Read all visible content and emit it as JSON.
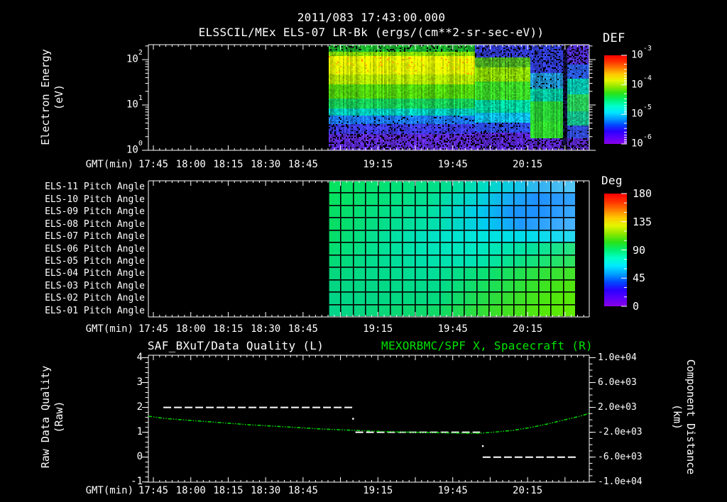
{
  "colors": {
    "background": "#000000",
    "foreground": "#ffffff",
    "title_green": "#00e400",
    "curve_green": "#00cf00",
    "quality_white": "#ffffff",
    "grid_black": "#000000",
    "rainbow_stops_bottom_to_top": [
      "#8a00e8",
      "#5a00fa",
      "#2a00ff",
      "#0048ff",
      "#00a0ff",
      "#00e8ff",
      "#00ffc8",
      "#00f070",
      "#2ce216",
      "#8ce800",
      "#e4f600",
      "#ffc800",
      "#ff7a00",
      "#ff3000",
      "#ff0000"
    ]
  },
  "header": {
    "line1": "2011/083 17:43:00.000",
    "line2": "ELSSCIL/MEx ELS-07 LR-Bk  (ergs/(cm**2-sr-sec-eV))"
  },
  "time_axis": {
    "label": "GMT(min)",
    "start": "17:43",
    "end": "20:40",
    "minutes_total": 176.7,
    "major_step_min": 15,
    "minor_step_min": 2.5,
    "first_tick_min": 2,
    "labels": [
      {
        "text": "17:45",
        "min": 2
      },
      {
        "text": "18:00",
        "min": 17
      },
      {
        "text": "18:15",
        "min": 32
      },
      {
        "text": "18:30",
        "min": 47
      },
      {
        "text": "18:45",
        "min": 62
      },
      {
        "text": "19:15",
        "min": 92
      },
      {
        "text": "19:45",
        "min": 122
      },
      {
        "text": "20:15",
        "min": 152
      }
    ]
  },
  "top_panel": {
    "ylabel": [
      "Electron Energy",
      "(eV)"
    ],
    "y_tick_exponents": [
      2,
      1,
      0
    ],
    "y_max_exponent": 2.33,
    "colorbar": {
      "title": "DEF",
      "tick_exponents": [
        -3,
        -4,
        -5,
        -6
      ]
    }
  },
  "mid_panel": {
    "row_labels": [
      "ELS-11 Pitch Angle",
      "ELS-10 Pitch Angle",
      "ELS-09 Pitch Angle",
      "ELS-08 Pitch Angle",
      "ELS-07 Pitch Angle",
      "ELS-06 Pitch Angle",
      "ELS-05 Pitch Angle",
      "ELS-04 Pitch Angle",
      "ELS-03 Pitch Angle",
      "ELS-02 Pitch Angle",
      "ELS-01 Pitch Angle"
    ],
    "colorbar": {
      "title": "Deg",
      "ticks": [
        180,
        135,
        90,
        45,
        0
      ],
      "minor_step": 15,
      "range": [
        0,
        180
      ]
    }
  },
  "bottom_panel": {
    "title_left": "SAF_BXuT/Data Quality (L)",
    "title_right": "MEXORBMC/SPF X, Spacecraft (R)",
    "ylabel_left": [
      "Raw Data Quality",
      "(Raw)"
    ],
    "ylabel_right": [
      "Component Distance",
      "(km)"
    ],
    "left_axis": {
      "ticks": [
        4,
        3,
        2,
        1,
        0,
        -1
      ],
      "minor_step": 0.2
    },
    "right_axis": {
      "tick_labels": [
        "1.0e+04",
        "6.0e+03",
        "2.0e+03",
        "-2.0e+03",
        "-6.0e+03",
        "-1.0e+04"
      ],
      "tick_values": [
        10000,
        6000,
        2000,
        -2000,
        -6000,
        -10000
      ],
      "range": [
        -10000,
        10000
      ],
      "minor_step": 1000
    }
  },
  "chart_data": [
    {
      "type": "heatmap",
      "name": "electron-energy-spectrogram",
      "title": "ELSSCIL/MEx ELS-07 LR-Bk",
      "units": "ergs/(cm**2-sr-sec-eV)",
      "x_start": "17:43",
      "x_end": "20:40",
      "data_start_min": 72,
      "data_end_min": 176.7,
      "y_scale": "log",
      "y_range_ev": [
        1,
        215
      ],
      "color_scale_range": [
        "1e-6",
        "1e-3"
      ],
      "segments": [
        {
          "x0": 0,
          "x1": 0.56,
          "bands": [
            {
              "y1": 0.055,
              "c": "#18a228",
              "n": 0.3,
              "b": 0.1
            },
            {
              "y1": 0.095,
              "c": "#7ed400",
              "n": 0.18
            },
            {
              "y1": 0.17,
              "c": "#e6f200",
              "n": 0.1,
              "sp": 0.05,
              "sc": "#ff9400"
            },
            {
              "y1": 0.27,
              "c": "#dcee00",
              "n": 0.1,
              "sp": 0.04,
              "sc": "#ffb000"
            },
            {
              "y1": 0.37,
              "c": "#adde00",
              "n": 0.12
            },
            {
              "y1": 0.5,
              "c": "#4ecc0c",
              "n": 0.14
            },
            {
              "y1": 0.595,
              "c": "#16c653",
              "n": 0.16
            },
            {
              "y1": 0.665,
              "c": "#00c2b2",
              "n": 0.2
            },
            {
              "y1": 0.74,
              "c": "#1a72ea",
              "n": 0.3,
              "b": 0.05
            },
            {
              "y1": 0.845,
              "c": "#3836d8",
              "n": 0.38,
              "b": 0.13
            },
            {
              "y1": 1,
              "c": "#5526c0",
              "n": 0.42,
              "b": 0.24
            }
          ]
        },
        {
          "x0": 0.56,
          "x1": 0.77,
          "bands": [
            {
              "y1": 0.11,
              "c": "#2c34bc",
              "n": 0.4,
              "b": 0.16
            },
            {
              "y1": 0.21,
              "c": "#48a41e",
              "n": 0.26
            },
            {
              "y1": 0.34,
              "c": "#84cc02",
              "n": 0.2
            },
            {
              "y1": 0.52,
              "c": "#38cc24",
              "n": 0.16
            },
            {
              "y1": 0.635,
              "c": "#00c896",
              "n": 0.2
            },
            {
              "y1": 0.725,
              "c": "#0ab0dc",
              "n": 0.22
            },
            {
              "y1": 0.83,
              "c": "#2a48dc",
              "n": 0.32,
              "b": 0.1
            },
            {
              "y1": 1,
              "c": "#4e22b8",
              "n": 0.42,
              "b": 0.22
            }
          ]
        },
        {
          "x0": 0.77,
          "x1": 0.895,
          "bands": [
            {
              "y1": 0.26,
              "c": "#2c38c4",
              "n": 0.4,
              "b": 0.18
            },
            {
              "y1": 0.41,
              "c": "#1e8cc8",
              "n": 0.3,
              "b": 0.06
            },
            {
              "y1": 0.53,
              "c": "#02be9a",
              "n": 0.2
            },
            {
              "y1": 0.72,
              "c": "#28cc34",
              "n": 0.12
            },
            {
              "y1": 0.875,
              "c": "#2ed42c",
              "n": 0.12
            },
            {
              "y1": 1,
              "c": "#5424bc",
              "n": 0.38,
              "b": 0.22
            }
          ]
        },
        {
          "x0": 0.895,
          "x1": 0.915,
          "bands": [
            {
              "y1": 1,
              "c": "#14103c",
              "n": 0.35,
              "b": 0.4
            }
          ]
        },
        {
          "x0": 0.915,
          "x1": 1,
          "bands": [
            {
              "y1": 0.18,
              "c": "#4c2ac2",
              "n": 0.38,
              "b": 0.22
            },
            {
              "y1": 0.31,
              "c": "#2858da",
              "n": 0.3,
              "b": 0.08
            },
            {
              "y1": 0.46,
              "c": "#04c2ae",
              "n": 0.2
            },
            {
              "y1": 0.63,
              "c": "#28cc58",
              "n": 0.16
            },
            {
              "y1": 0.76,
              "c": "#14bc8a",
              "n": 0.2
            },
            {
              "y1": 0.885,
              "c": "#2e48cc",
              "n": 0.32,
              "b": 0.12
            },
            {
              "y1": 1,
              "c": "#5022b2",
              "n": 0.38,
              "b": 0.26
            }
          ]
        }
      ]
    },
    {
      "type": "heatmap",
      "name": "pitch-angle-panels",
      "data_start_min": 72,
      "data_end_min": 171,
      "value_range_deg": [
        0,
        180
      ],
      "grid_columns": 20,
      "rows": [
        {
          "label": "ELS-11 Pitch Angle",
          "stops": [
            [
              0,
              "#06e25e"
            ],
            [
              0.45,
              "#00e08a"
            ],
            [
              0.62,
              "#00dcc0"
            ],
            [
              0.75,
              "#10c8e8"
            ],
            [
              0.86,
              "#38b2f2"
            ],
            [
              1,
              "#55c8f5"
            ]
          ]
        },
        {
          "label": "ELS-10 Pitch Angle",
          "stops": [
            [
              0,
              "#06e25e"
            ],
            [
              0.42,
              "#00e096"
            ],
            [
              0.6,
              "#00d4d8"
            ],
            [
              0.74,
              "#18a8f8"
            ],
            [
              0.84,
              "#1e90ff"
            ],
            [
              1,
              "#34a4ff"
            ]
          ]
        },
        {
          "label": "ELS-09 Pitch Angle",
          "stops": [
            [
              0,
              "#06de62"
            ],
            [
              0.42,
              "#00e0a4"
            ],
            [
              0.6,
              "#00ccec"
            ],
            [
              0.74,
              "#1895fa"
            ],
            [
              0.85,
              "#1e90ff"
            ],
            [
              1,
              "#3cabff"
            ]
          ]
        },
        {
          "label": "ELS-08 Pitch Angle",
          "stops": [
            [
              0,
              "#06de62"
            ],
            [
              0.45,
              "#00e0b2"
            ],
            [
              0.63,
              "#00cdf0"
            ],
            [
              0.78,
              "#1e98ff"
            ],
            [
              1,
              "#4ab4ff"
            ]
          ]
        },
        {
          "label": "ELS-07 Pitch Angle",
          "stops": [
            [
              0,
              "#06de66"
            ],
            [
              0.4,
              "#00e2c2"
            ],
            [
              0.58,
              "#00e6da"
            ],
            [
              0.8,
              "#00dcec"
            ],
            [
              1,
              "#28d8f0"
            ]
          ]
        },
        {
          "label": "ELS-06 Pitch Angle",
          "stops": [
            [
              0,
              "#04de6e"
            ],
            [
              0.4,
              "#00e4b8"
            ],
            [
              0.6,
              "#00e8c4"
            ],
            [
              0.8,
              "#00e2a0"
            ],
            [
              1,
              "#2ae47e"
            ]
          ]
        },
        {
          "label": "ELS-05 Pitch Angle",
          "stops": [
            [
              0,
              "#04da74"
            ],
            [
              0.38,
              "#00e0aa"
            ],
            [
              0.58,
              "#00e4b4"
            ],
            [
              0.78,
              "#0ce284"
            ],
            [
              1,
              "#30e45c"
            ]
          ]
        },
        {
          "label": "ELS-04 Pitch Angle",
          "stops": [
            [
              0,
              "#03d87c"
            ],
            [
              0.42,
              "#00de9a"
            ],
            [
              0.65,
              "#0ce070"
            ],
            [
              0.85,
              "#2ee23e"
            ],
            [
              1,
              "#44e426"
            ]
          ]
        },
        {
          "label": "ELS-03 Pitch Angle",
          "stops": [
            [
              0,
              "#03d682"
            ],
            [
              0.45,
              "#00dc8c"
            ],
            [
              0.68,
              "#1ee052"
            ],
            [
              0.88,
              "#3ee41e"
            ],
            [
              1,
              "#52e60e"
            ]
          ]
        },
        {
          "label": "ELS-02 Pitch Angle",
          "stops": [
            [
              0,
              "#02d488"
            ],
            [
              0.45,
              "#04da7e"
            ],
            [
              0.68,
              "#2edd3a"
            ],
            [
              0.88,
              "#4ce612"
            ],
            [
              1,
              "#5aea06"
            ]
          ]
        },
        {
          "label": "ELS-01 Pitch Angle",
          "stops": [
            [
              0,
              "#02d48a"
            ],
            [
              0.45,
              "#10da66"
            ],
            [
              0.68,
              "#3cdf28"
            ],
            [
              0.88,
              "#55e80a"
            ],
            [
              1,
              "#63ee02"
            ]
          ]
        }
      ]
    },
    {
      "type": "line",
      "name": "raw-data-quality",
      "axis": "left",
      "color": "#ffffff",
      "style": "dashed",
      "segments": [
        {
          "t0_min": 6,
          "t1_min": 82,
          "value": 2
        },
        {
          "t0_min": 83,
          "t1_min": 133,
          "value": 1
        },
        {
          "t0_min": 134,
          "t1_min": 172,
          "value": 0
        }
      ],
      "points": [
        {
          "t_min": 82,
          "value": 1.55
        },
        {
          "t_min": 134,
          "value": 0.45
        }
      ]
    },
    {
      "type": "line",
      "name": "spacecraft-x-distance",
      "axis": "right",
      "color": "#00cf00",
      "style": "dash-dot",
      "t_min": [
        0,
        6,
        17,
        29,
        40,
        55,
        69,
        83,
        97,
        112,
        126,
        133,
        140,
        146,
        153,
        160,
        167,
        173,
        176.7
      ],
      "km": [
        580,
        240,
        -100,
        -450,
        -790,
        -1130,
        -1470,
        -1700,
        -1930,
        -2040,
        -2160,
        -2160,
        -1930,
        -1700,
        -1250,
        -670,
        10,
        580,
        1040
      ]
    }
  ]
}
